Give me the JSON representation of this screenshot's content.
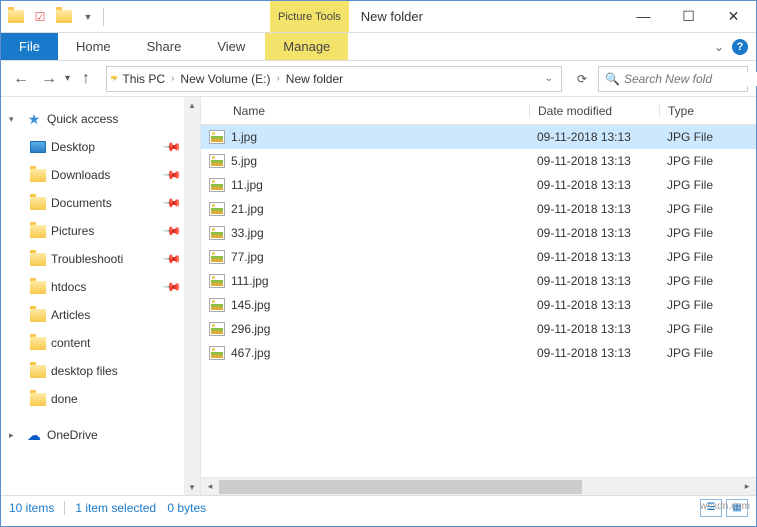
{
  "title": "New folder",
  "picture_tools_label": "Picture Tools",
  "ribbon": {
    "file": "File",
    "tabs": [
      "Home",
      "Share",
      "View"
    ],
    "manage": "Manage"
  },
  "breadcrumb": [
    "This PC",
    "New Volume (E:)",
    "New folder"
  ],
  "search_placeholder": "Search New fold",
  "sidebar": {
    "quick_access": "Quick access",
    "items": [
      {
        "label": "Desktop",
        "pinned": true,
        "icon": "desktop"
      },
      {
        "label": "Downloads",
        "pinned": true,
        "icon": "folder"
      },
      {
        "label": "Documents",
        "pinned": true,
        "icon": "folder"
      },
      {
        "label": "Pictures",
        "pinned": true,
        "icon": "folder"
      },
      {
        "label": "Troubleshooti",
        "pinned": true,
        "icon": "folder"
      },
      {
        "label": "htdocs",
        "pinned": true,
        "icon": "folder"
      },
      {
        "label": "Articles",
        "pinned": false,
        "icon": "folder"
      },
      {
        "label": "content",
        "pinned": false,
        "icon": "folder"
      },
      {
        "label": "desktop files",
        "pinned": false,
        "icon": "folder"
      },
      {
        "label": "done",
        "pinned": false,
        "icon": "folder"
      }
    ],
    "onedrive": "OneDrive"
  },
  "columns": {
    "name": "Name",
    "date": "Date modified",
    "type": "Type"
  },
  "files": [
    {
      "name": "1.jpg",
      "date": "09-11-2018 13:13",
      "type": "JPG File",
      "selected": true
    },
    {
      "name": "5.jpg",
      "date": "09-11-2018 13:13",
      "type": "JPG File",
      "selected": false
    },
    {
      "name": "11.jpg",
      "date": "09-11-2018 13:13",
      "type": "JPG File",
      "selected": false
    },
    {
      "name": "21.jpg",
      "date": "09-11-2018 13:13",
      "type": "JPG File",
      "selected": false
    },
    {
      "name": "33.jpg",
      "date": "09-11-2018 13:13",
      "type": "JPG File",
      "selected": false
    },
    {
      "name": "77.jpg",
      "date": "09-11-2018 13:13",
      "type": "JPG File",
      "selected": false
    },
    {
      "name": "111.jpg",
      "date": "09-11-2018 13:13",
      "type": "JPG File",
      "selected": false
    },
    {
      "name": "145.jpg",
      "date": "09-11-2018 13:13",
      "type": "JPG File",
      "selected": false
    },
    {
      "name": "296.jpg",
      "date": "09-11-2018 13:13",
      "type": "JPG File",
      "selected": false
    },
    {
      "name": "467.jpg",
      "date": "09-11-2018 13:13",
      "type": "JPG File",
      "selected": false
    }
  ],
  "status": {
    "count": "10 items",
    "selection": "1 item selected",
    "size": "0 bytes"
  },
  "watermark": "wsxdn.com"
}
